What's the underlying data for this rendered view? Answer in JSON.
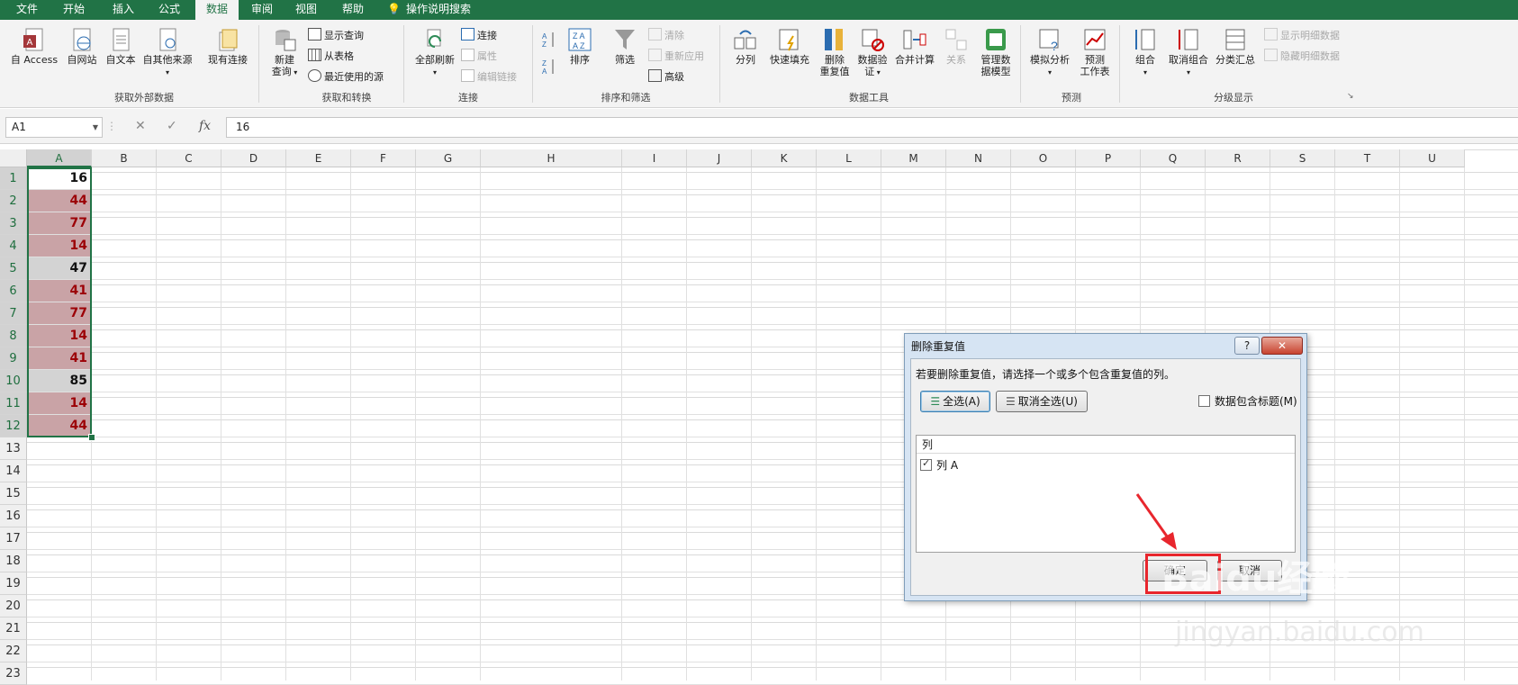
{
  "menu": {
    "tabs": [
      {
        "label": "文件"
      },
      {
        "label": "开始"
      },
      {
        "label": "插入"
      },
      {
        "label": "公式"
      },
      {
        "label": "数据"
      },
      {
        "label": "审阅"
      },
      {
        "label": "视图"
      },
      {
        "label": "帮助"
      }
    ],
    "search_label": "操作说明搜索"
  },
  "ribbon": {
    "external": {
      "access": "自 Access",
      "web": "自网站",
      "text": "自文本",
      "other": "自其他来源",
      "existing": "现有连接",
      "group": "获取外部数据"
    },
    "transform": {
      "newquery_line1": "新建",
      "newquery_line2": "查询",
      "show": "显示查询",
      "from_table": "从表格",
      "recent": "最近使用的源",
      "group": "获取和转换"
    },
    "connections": {
      "refresh": "全部刷新",
      "conn": "连接",
      "props": "属性",
      "edit_links": "编辑链接",
      "group": "连接"
    },
    "sortfilter": {
      "sort": "排序",
      "filter": "筛选",
      "clear": "清除",
      "reapply": "重新应用",
      "advanced": "高级",
      "group": "排序和筛选"
    },
    "datatools": {
      "split": "分列",
      "flash": "快速填充",
      "remove_dup_line1": "删除",
      "remove_dup_line2": "重复值",
      "validate_line1": "数据验",
      "validate_line2": "证",
      "consolidate": "合并计算",
      "relations": "关系",
      "model_line1": "管理数",
      "model_line2": "据模型",
      "group": "数据工具"
    },
    "forecast": {
      "whatif": "模拟分析",
      "forecast_line1": "预测",
      "forecast_line2": "工作表",
      "group": "预测"
    },
    "outline": {
      "group_btn": "组合",
      "ungroup": "取消组合",
      "subtotal": "分类汇总",
      "show_detail": "显示明细数据",
      "hide_detail": "隐藏明细数据",
      "group": "分级显示"
    }
  },
  "formula_bar": {
    "name_box": "A1",
    "fx": "fx",
    "value": "16"
  },
  "columns": [
    "A",
    "B",
    "C",
    "D",
    "E",
    "F",
    "G",
    "H",
    "I",
    "J",
    "K",
    "L",
    "M",
    "N",
    "O",
    "P",
    "Q",
    "R",
    "S",
    "T",
    "U"
  ],
  "rows": [
    "1",
    "2",
    "3",
    "4",
    "5",
    "6",
    "7",
    "8",
    "9",
    "10",
    "11",
    "12",
    "13",
    "14",
    "15",
    "16",
    "17",
    "18",
    "19",
    "20",
    "21",
    "22",
    "23"
  ],
  "cells_A": [
    "16",
    "44",
    "77",
    "14",
    "47",
    "41",
    "77",
    "14",
    "41",
    "85",
    "14",
    "44"
  ],
  "cell_styles": [
    "first",
    "dup",
    "dup",
    "dup",
    "uniq",
    "dup",
    "dup",
    "dup",
    "dup",
    "uniq",
    "dup",
    "dup"
  ],
  "dialog": {
    "title": "删除重复值",
    "help": "?",
    "close": "✕",
    "description": "若要删除重复值，请选择一个或多个包含重复值的列。",
    "select_all": "全选(A)",
    "unselect_all": "取消全选(U)",
    "has_headers": "数据包含标题(M)",
    "list_header": "列",
    "column_item": "列 A",
    "ok": "确定",
    "cancel": "取消"
  },
  "watermark": {
    "brand": "Baidu经验",
    "url": "jingyan.baidu.com"
  },
  "colors": {
    "excel_green": "#217346",
    "dup_fill": "#c9a3a6",
    "dup_text": "#9c0006",
    "annotation_red": "#e8262d"
  }
}
